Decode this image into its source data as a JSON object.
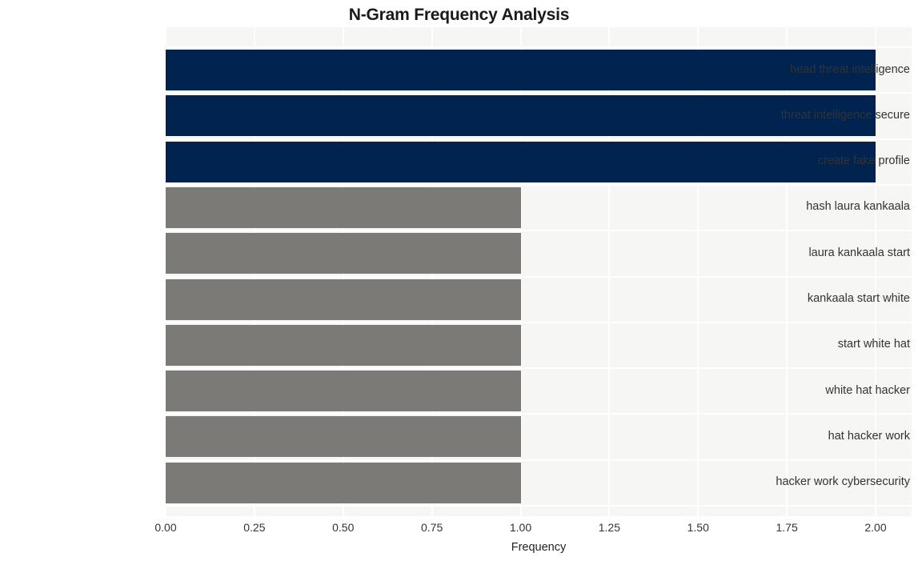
{
  "chart_data": {
    "type": "bar",
    "orientation": "horizontal",
    "title": "N-Gram Frequency Analysis",
    "xlabel": "Frequency",
    "ylabel": "",
    "xlim": [
      0.0,
      2.0
    ],
    "xticks": [
      "0.00",
      "0.25",
      "0.50",
      "0.75",
      "1.00",
      "1.25",
      "1.50",
      "1.75",
      "2.00"
    ],
    "xtick_values": [
      0.0,
      0.25,
      0.5,
      0.75,
      1.0,
      1.25,
      1.5,
      1.75,
      2.0
    ],
    "grid": true,
    "legend": "none",
    "categories": [
      "head threat intelligence",
      "threat intelligence secure",
      "create fake profile",
      "hash laura kankaala",
      "laura kankaala start",
      "kankaala start white",
      "start white hat",
      "white hat hacker",
      "hat hacker work",
      "hacker work cybersecurity"
    ],
    "values": [
      2,
      2,
      2,
      1,
      1,
      1,
      1,
      1,
      1,
      1
    ],
    "bar_colors": [
      "#00234f",
      "#00234f",
      "#00234f",
      "#7b7a77",
      "#7b7a77",
      "#7b7a77",
      "#7b7a77",
      "#7b7a77",
      "#7b7a77",
      "#7b7a77"
    ],
    "bars": [
      {
        "label": "head threat intelligence",
        "value": 2,
        "color": "#00234f"
      },
      {
        "label": "threat intelligence secure",
        "value": 2,
        "color": "#00234f"
      },
      {
        "label": "create fake profile",
        "value": 2,
        "color": "#00234f"
      },
      {
        "label": "hash laura kankaala",
        "value": 1,
        "color": "#7b7a77"
      },
      {
        "label": "laura kankaala start",
        "value": 1,
        "color": "#7b7a77"
      },
      {
        "label": "kankaala start white",
        "value": 1,
        "color": "#7b7a77"
      },
      {
        "label": "start white hat",
        "value": 1,
        "color": "#7b7a77"
      },
      {
        "label": "white hat hacker",
        "value": 1,
        "color": "#7b7a77"
      },
      {
        "label": "hat hacker work",
        "value": 1,
        "color": "#7b7a77"
      },
      {
        "label": "hacker work cybersecurity",
        "value": 1,
        "color": "#7b7a77"
      }
    ],
    "colors": {
      "plot_background": "#f6f6f5",
      "figure_background": "#ffffff",
      "gridline": "#ffffff",
      "highlight_bar": "#00234f",
      "normal_bar": "#7b7a77",
      "text": "#333333",
      "title_text": "#1a1a1a"
    }
  }
}
